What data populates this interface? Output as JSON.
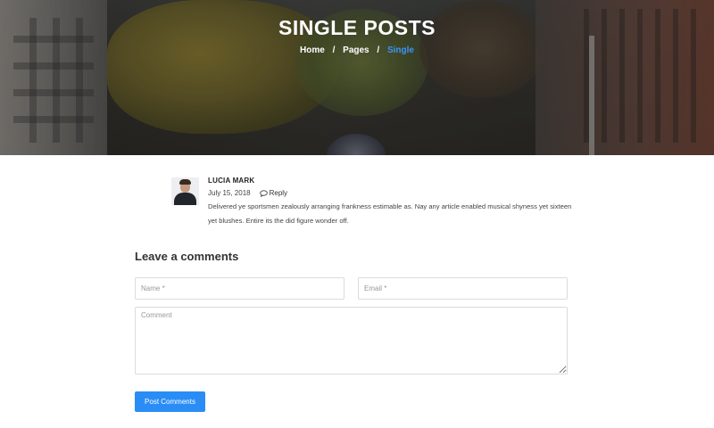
{
  "hero": {
    "title": "SINGLE POSTS",
    "breadcrumb": {
      "items": [
        "Home",
        "Pages"
      ],
      "separator": "/",
      "current": "Single"
    }
  },
  "comment": {
    "author": "LUCIA MARK",
    "date": "July 15, 2018",
    "reply_label": "Reply",
    "text": "Delivered ye sportsmen zealously arranging frankness estimable as. Nay any article enabled musical shyness yet sixteen yet blushes. Entire its the did figure wonder off."
  },
  "form": {
    "title": "Leave a comments",
    "name_placeholder": "Name *",
    "email_placeholder": "Email *",
    "comment_placeholder": "Comment",
    "submit_label": "Post Comments"
  },
  "colors": {
    "accent": "#2a8df5",
    "breadcrumb_current": "#3d94f6"
  },
  "icons": {
    "reply": "speech-bubble-icon"
  }
}
